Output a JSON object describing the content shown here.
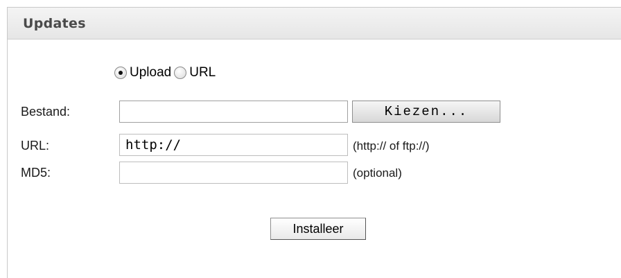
{
  "panel": {
    "title": "Updates"
  },
  "source": {
    "options": [
      {
        "label": "Upload",
        "selected": true
      },
      {
        "label": "URL",
        "selected": false
      }
    ]
  },
  "form": {
    "file_label": "Bestand:",
    "file_value": "",
    "browse_label": "Kiezen...",
    "url_label": "URL:",
    "url_value": "http://",
    "url_hint": "(http:// of ftp://)",
    "md5_label": "MD5:",
    "md5_value": "",
    "md5_hint": "(optional)",
    "submit_label": "Installeer"
  }
}
